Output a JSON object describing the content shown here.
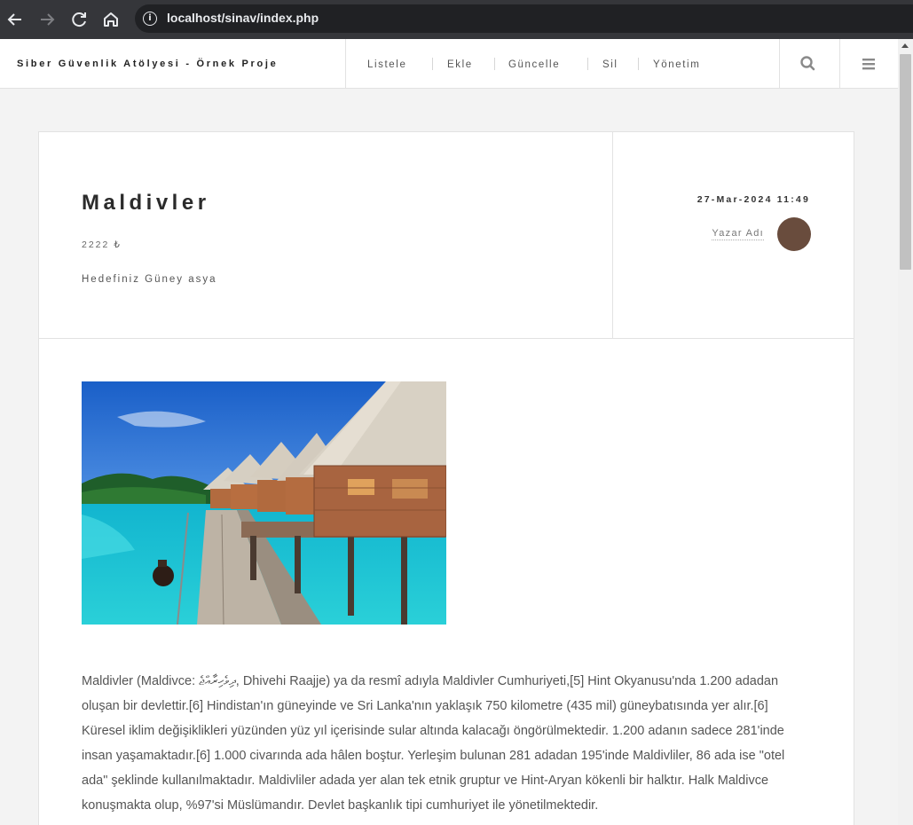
{
  "browser": {
    "back_icon": "arrow-left",
    "forward_icon": "arrow-right",
    "reload_icon": "reload",
    "home_icon": "home",
    "url": "localhost/sinav/index.php"
  },
  "site": {
    "brand": "Siber Güvenlik Atölyesi - Örnek Proje",
    "menu": [
      "Listele",
      "Ekle",
      "Güncelle",
      "Sil",
      "Yönetim"
    ],
    "search_icon": "search",
    "menu_icon": "hamburger"
  },
  "article": {
    "title": "Maldivler",
    "price": "2222 ₺",
    "subtitle": "Hedefiniz Güney asya",
    "date": "27-Mar-2024 11:49",
    "author": "Yazar Adı",
    "avatar_color": "#694c3d",
    "image_subject": "overwater bungalows over turquoise lagoon with wooden boardwalk",
    "body": "Maldivler (Maldivce: ދިވެހިރާއްޖެ, Dhivehi Raajje) ya da resmî adıyla Maldivler Cumhuriyeti,[5] Hint Okyanusu'nda 1.200 adadan oluşan bir devlettir.[6] Hindistan'ın güneyinde ve Sri Lanka'nın yaklaşık 750 kilometre (435 mil) güneybatısında yer alır.[6] Küresel iklim değişiklikleri yüzünden yüz yıl içerisinde sular altında kalacağı öngörülmektedir. 1.200 adanın sadece 281'inde insan yaşamaktadır.[6] 1.000 civarında ada hâlen boştur. Yerleşim bulunan 281 adadan 195'inde Maldivliler, 86 ada ise \"otel ada\" şeklinde kullanılmaktadır. Maldivliler adada yer alan tek etnik gruptur ve Hint-Aryan kökenli bir halktır. Halk Maldivce konuşmakta olup, %97'si Müslümandır. Devlet başkanlık tipi cumhuriyet ile yönetilmektedir."
  }
}
